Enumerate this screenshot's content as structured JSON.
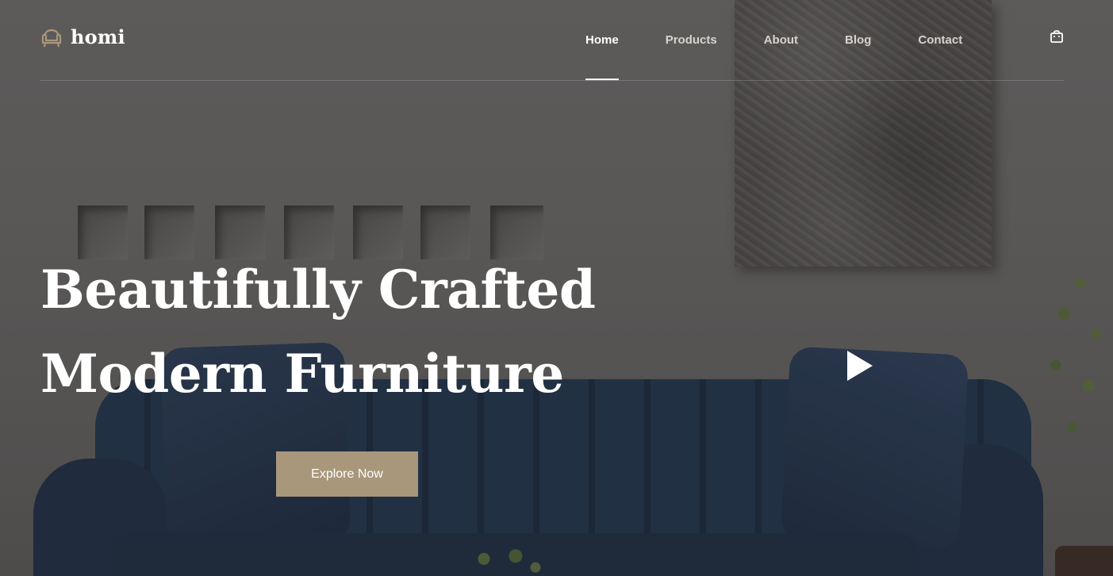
{
  "brand": {
    "name": "homi",
    "logo_icon": "armchair-icon",
    "accent_color": "#a8977a"
  },
  "nav": {
    "items": [
      {
        "label": "Home",
        "active": true
      },
      {
        "label": "Products",
        "active": false
      },
      {
        "label": "About",
        "active": false
      },
      {
        "label": "Blog",
        "active": false
      },
      {
        "label": "Contact",
        "active": false
      }
    ],
    "cart_icon": "shopping-bag-icon"
  },
  "hero": {
    "headline_line1": "Beautifully Crafted",
    "headline_line2": "Modern Furniture",
    "cta_label": "Explore Now",
    "play_icon": "play-icon"
  }
}
